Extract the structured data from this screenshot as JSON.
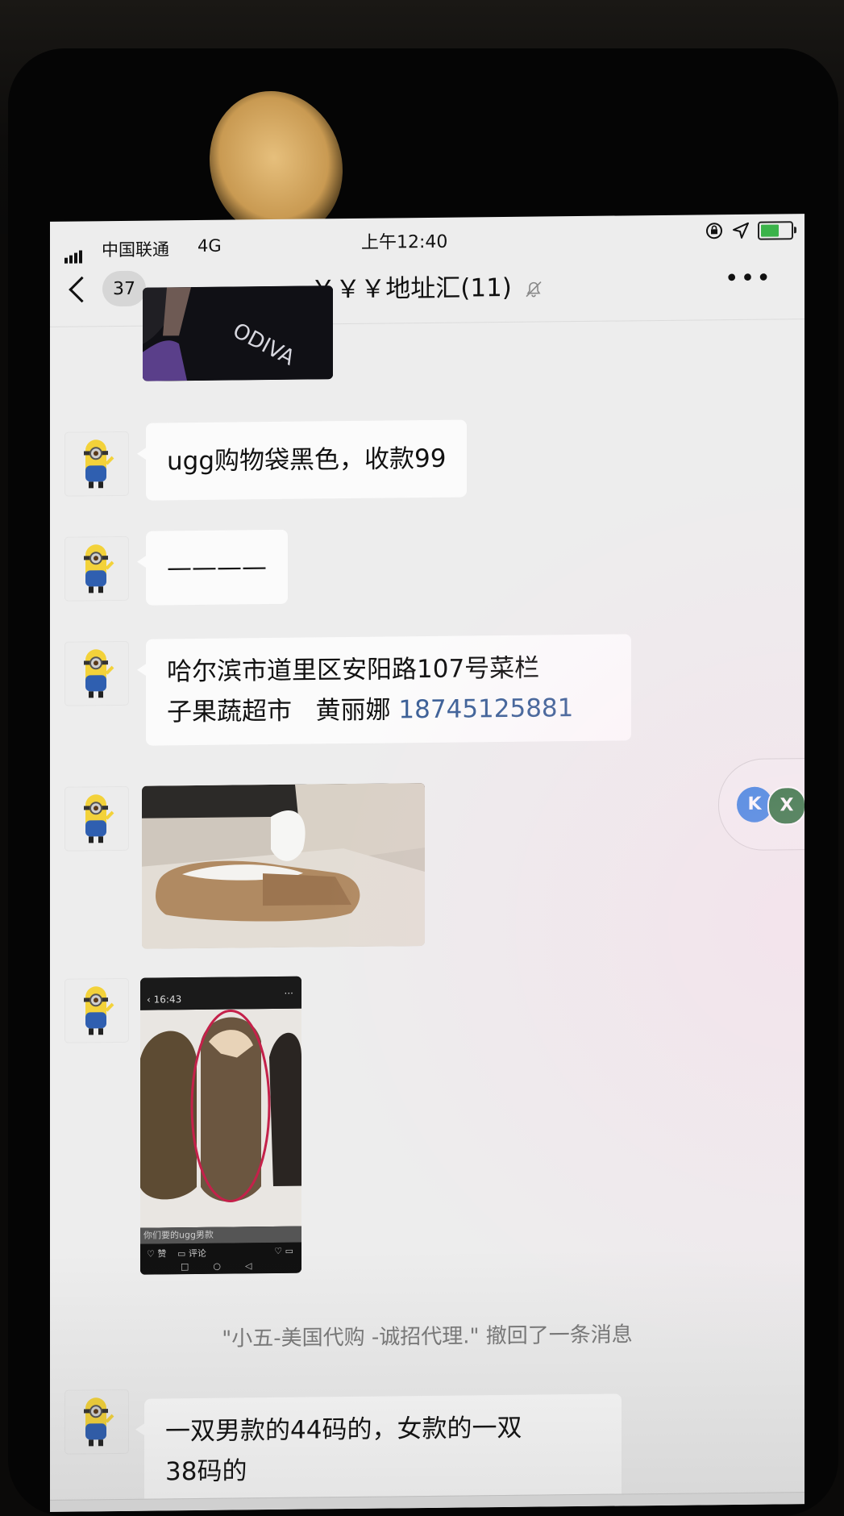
{
  "status_bar": {
    "carrier": "中国联通",
    "network": "4G",
    "time": "上午12:40"
  },
  "nav": {
    "unread_count": "37",
    "title": "￥￥￥地址汇(11)"
  },
  "messages": [
    {
      "type": "image",
      "text": "ODIVA"
    },
    {
      "type": "text",
      "text": "ugg购物袋黑色，收款99"
    },
    {
      "type": "text",
      "text": "————"
    },
    {
      "type": "text",
      "line1": "哈尔滨市道里区安阳路107号菜栏",
      "line2": "子果蔬超市   黄丽娜 ",
      "phone": "18745125881"
    },
    {
      "type": "image",
      "text": ""
    },
    {
      "type": "image",
      "time": "16:43",
      "caption": "你们要的ugg男款",
      "like": "赞",
      "comment": "评论"
    },
    {
      "type": "system",
      "text": "\"小五-美国代购 -诚招代理.\" 撤回了一条消息"
    },
    {
      "type": "text",
      "line1": "一双男款的44码的，女款的一双",
      "line2": "38码的"
    }
  ],
  "floating_widget": {
    "left_icon": "K",
    "right_icon": "X"
  }
}
